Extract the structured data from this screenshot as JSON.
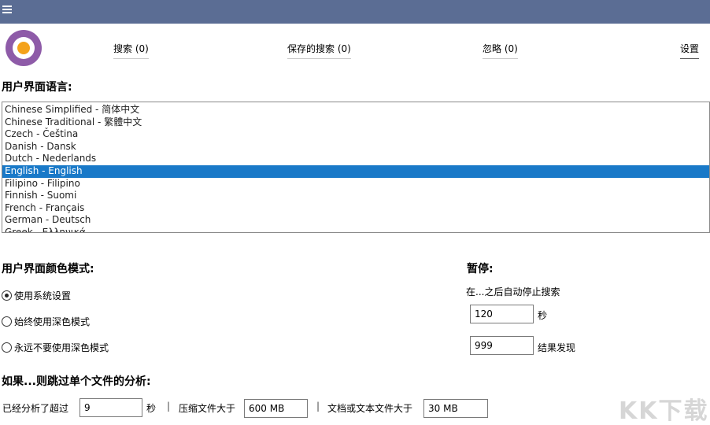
{
  "header": {
    "menu_icon": "hamburger-menu-icon",
    "logo_icon": "app-logo-icon",
    "tabs": [
      {
        "label": "搜索 (0)"
      },
      {
        "label": "保存的搜索 (0)"
      },
      {
        "label": "忽略 (0)"
      },
      {
        "label": "设置"
      }
    ],
    "active_tab": "设置"
  },
  "language": {
    "heading": "用户界面语言:",
    "items": [
      "Chinese Simplified - 简体中文",
      "Chinese Traditional - 繁體中文",
      "Czech - Čeština",
      "Danish - Dansk",
      "Dutch - Nederlands",
      "English - English",
      "Filipino - Filipino",
      "Finnish - Suomi",
      "French - Français",
      "German - Deutsch",
      "Greek - Ελληνικά"
    ],
    "selected": "English - English"
  },
  "color_mode": {
    "heading": "用户界面颜色模式:",
    "options": [
      "使用系统设置",
      "始终使用深色模式",
      "永远不要使用深色模式"
    ],
    "selected": "使用系统设置"
  },
  "pause": {
    "heading": "暂停:",
    "description": "在...之后自动停止搜索",
    "seconds_value": "120",
    "seconds_unit": "秒",
    "results_value": "999",
    "results_unit": "结果发现"
  },
  "skip": {
    "heading": "如果...则跳过单个文件的分析:",
    "analyzed_label": "已经分析了超过",
    "analyzed_value": "9",
    "analyzed_unit": "秒",
    "separator": "|",
    "compressed_label": "压缩文件大于",
    "compressed_value": "600 MB",
    "document_label": "文档或文本文件大于",
    "document_value": "30 MB"
  },
  "watermark": "KK下载",
  "colors": {
    "titlebar": "#5b6d94",
    "selection": "#1979c8",
    "logo": "#8e5ba8"
  }
}
